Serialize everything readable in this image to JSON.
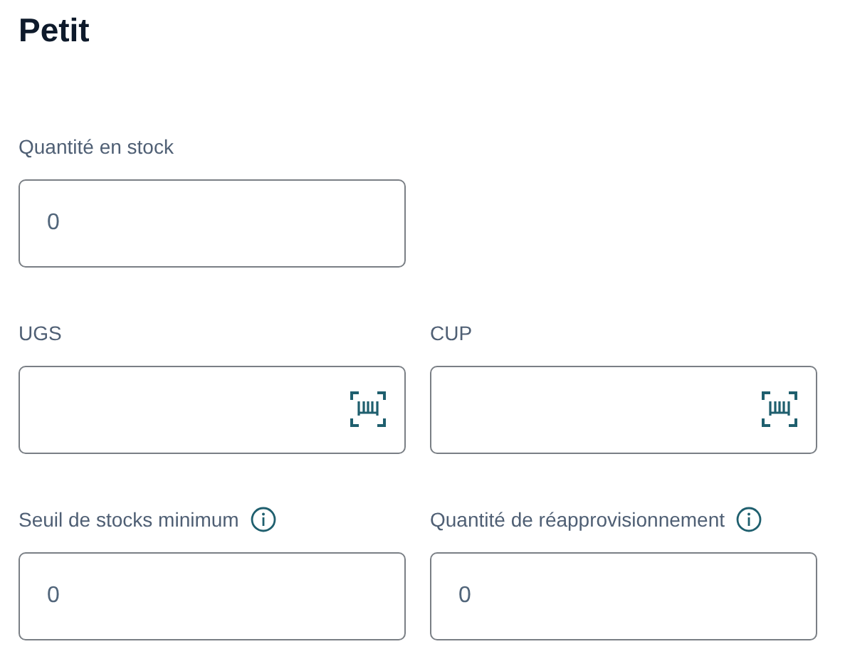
{
  "title": "Petit",
  "rows": [
    {
      "fields": [
        {
          "label": "Quantité en stock",
          "value": "0",
          "kind": "plain",
          "info": false
        }
      ]
    },
    {
      "fields": [
        {
          "label": "UGS",
          "kind": "scan",
          "info": false
        },
        {
          "label": "CUP",
          "kind": "scan",
          "info": false
        }
      ]
    },
    {
      "fields": [
        {
          "label": "Seuil de stocks minimum",
          "value": "0",
          "kind": "plain",
          "info": true
        },
        {
          "label": "Quantité de réapprovisionnement",
          "value": "0",
          "kind": "plain",
          "info": true
        }
      ]
    }
  ]
}
